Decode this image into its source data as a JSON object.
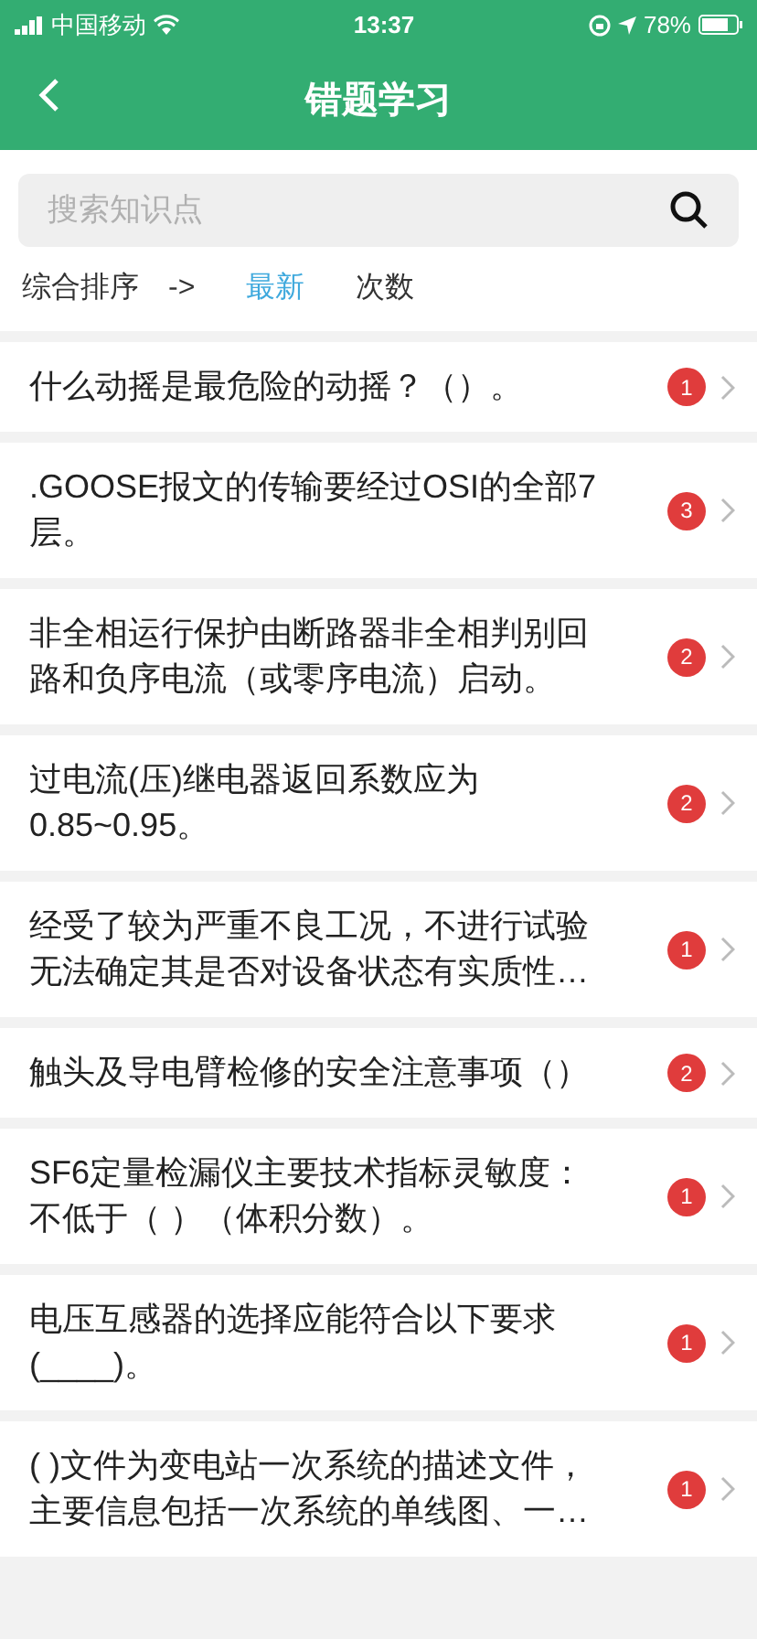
{
  "status_bar": {
    "carrier": "中国移动",
    "time": "13:37",
    "battery": "78%"
  },
  "header": {
    "title": "错题学习"
  },
  "search": {
    "placeholder": "搜索知识点"
  },
  "sort": {
    "label": "综合排序",
    "arrow": "->",
    "options": [
      {
        "label": "最新",
        "selected": true
      },
      {
        "label": "次数",
        "selected": false
      }
    ]
  },
  "questions": [
    {
      "text": "什么动摇是最危险的动摇？（）。",
      "count": "1"
    },
    {
      "text": ".GOOSE报文的传输要经过OSI的全部7层。",
      "count": "3"
    },
    {
      "text": "非全相运行保护由断路器非全相判别回路和负序电流（或零序电流）启动。",
      "count": "2"
    },
    {
      "text": "过电流(压)继电器返回系数应为0.85~0.95。",
      "count": "2"
    },
    {
      "text": "经受了较为严重不良工况，不进行试验无法确定其是否对设备状态有实质性…",
      "count": "1"
    },
    {
      "text": "触头及导电臂检修的安全注意事项（）",
      "count": "2"
    },
    {
      "text": "SF6定量检漏仪主要技术指标灵敏度：不低于（ ）（体积分数）。",
      "count": "1"
    },
    {
      "text": "电压互感器的选择应能符合以下要求(____)。",
      "count": "1"
    },
    {
      "text": "( )文件为变电站一次系统的描述文件，主要信息包括一次系统的单线图、一…",
      "count": "1"
    }
  ]
}
